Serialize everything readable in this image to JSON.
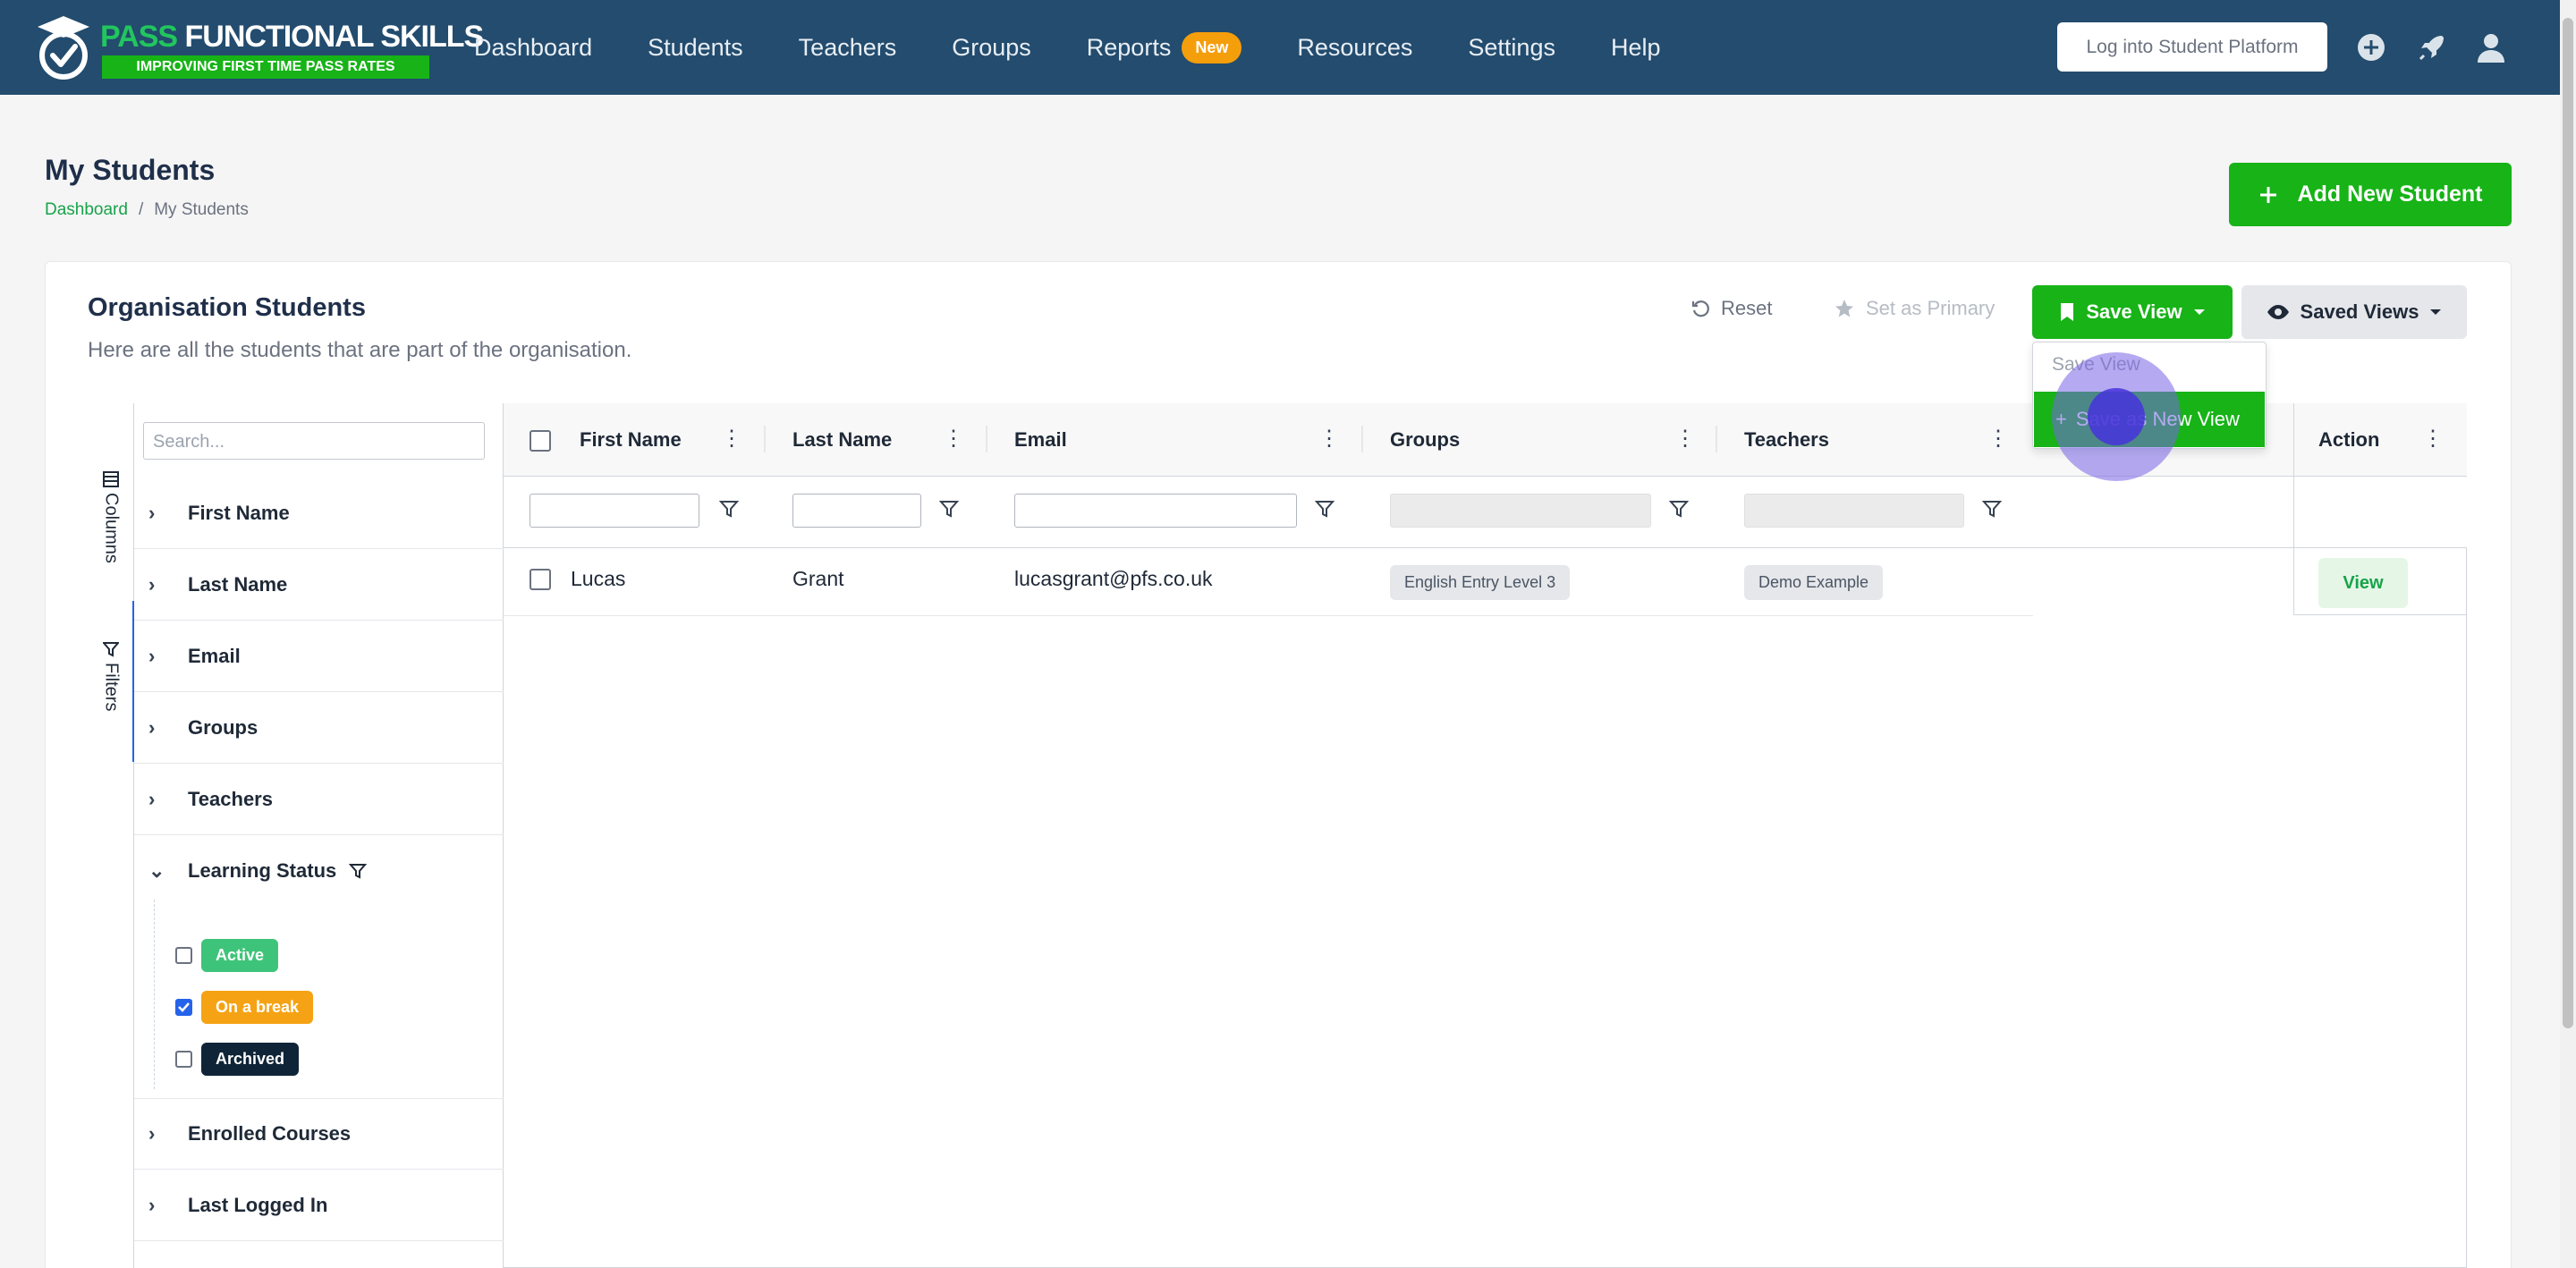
{
  "brand": {
    "title_part1": "PASS",
    "title_part2": "FUNCTIONAL SKILLS",
    "tagline": "IMPROVING FIRST TIME PASS RATES"
  },
  "nav": {
    "links": [
      "Dashboard",
      "Students",
      "Teachers",
      "Groups",
      "Reports",
      "Resources",
      "Settings",
      "Help"
    ],
    "reports_badge": "New",
    "login_button": "Log into Student Platform",
    "icons": [
      "plus-circle-icon",
      "rocket-icon",
      "user-icon"
    ]
  },
  "page": {
    "title": "My Students",
    "breadcrumb": {
      "home": "Dashboard",
      "current": "My Students"
    },
    "add_button": "Add New Student"
  },
  "card": {
    "title": "Organisation Students",
    "subtitle": "Here are all the students that are part of the organisation.",
    "reset": "Reset",
    "set_primary": "Set as Primary",
    "save_view": "Save View",
    "saved_views": "Saved Views"
  },
  "dropdown": {
    "item1": "Save View",
    "item2": "Save as New View"
  },
  "sidebar": {
    "tabs": [
      "Columns",
      "Filters"
    ],
    "search_placeholder": "Search...",
    "filters": [
      "First Name",
      "Last Name",
      "Email",
      "Groups",
      "Teachers",
      "Learning Status",
      "Enrolled Courses",
      "Last Logged In"
    ],
    "learning_status": [
      {
        "label": "Active",
        "checked": false,
        "color": "#3ec47a"
      },
      {
        "label": "On a break",
        "checked": true,
        "color": "#f5a314"
      },
      {
        "label": "Archived",
        "checked": false,
        "color": "#0f2437"
      }
    ]
  },
  "table": {
    "columns": [
      "First Name",
      "Last Name",
      "Email",
      "Groups",
      "Teachers",
      "Action"
    ],
    "rows": [
      {
        "first_name": "Lucas",
        "last_name": "Grant",
        "email": "lucasgrant@pfs.co.uk",
        "group": "English Entry Level 3",
        "teacher": "Demo Example",
        "action": "View"
      }
    ]
  },
  "colors": {
    "nav_bg": "#234c6e",
    "accent_green": "#17b317",
    "badge_orange": "#f59e0b"
  }
}
